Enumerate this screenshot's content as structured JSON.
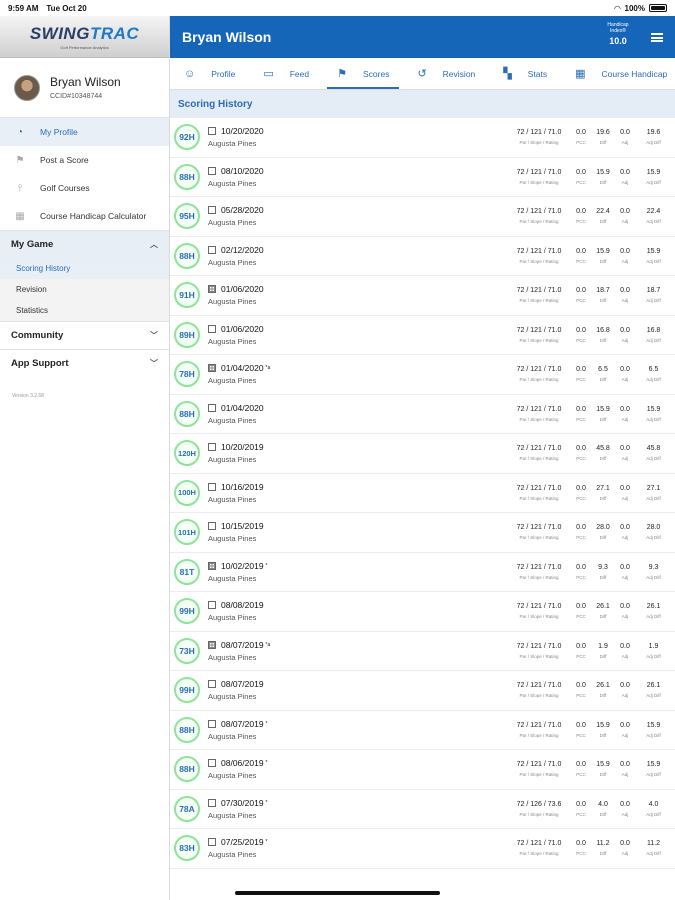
{
  "status": {
    "time": "9:59 AM",
    "date": "Tue Oct 20",
    "battery": "100%"
  },
  "brand": {
    "logo_a": "SWING",
    "logo_b": "TRAC",
    "tagline": "Golf Performance Analytics"
  },
  "user": {
    "name": "Bryan Wilson",
    "id": "CCID#10348744"
  },
  "nav": [
    {
      "label": "My Profile",
      "icon": "profile-icon",
      "glyph": "◔"
    },
    {
      "label": "Post a Score",
      "icon": "flag-icon",
      "glyph": "⚑"
    },
    {
      "label": "Golf Courses",
      "icon": "golf-tee-icon",
      "glyph": "⫯"
    },
    {
      "label": "Course Handicap Calculator",
      "icon": "calculator-icon",
      "glyph": "▦"
    }
  ],
  "sections": {
    "my_game": "My Game",
    "my_game_items": [
      "Scoring History",
      "Revision",
      "Statistics"
    ],
    "community": "Community",
    "app_support": "App Support"
  },
  "version": "Version 3.2.68",
  "header": {
    "title": "Bryan Wilson",
    "handicap_label": "Handicap Index®",
    "handicap_value": "10.0"
  },
  "tabs": [
    {
      "label": "Profile",
      "glyph": "☺"
    },
    {
      "label": "Feed",
      "glyph": "▭"
    },
    {
      "label": "Scores",
      "glyph": "⚑"
    },
    {
      "label": "Revision",
      "glyph": "↺"
    },
    {
      "label": "Stats",
      "glyph": "▚"
    },
    {
      "label": "Course Handicap",
      "glyph": "▦"
    }
  ],
  "list_title": "Scoring History",
  "stat_labels": {
    "prs": "Par / Slope / Rating",
    "pcc": "PCC",
    "diff": "Diff",
    "adj": "Adj",
    "adjdiff": "Adj Diff"
  },
  "colors": {
    "brand_blue": "#1566b8",
    "badge_border": "#8fe39a",
    "link_blue": "#2b6cb8"
  },
  "scores": [
    {
      "score": "92H",
      "date": "10/20/2020",
      "mark": "",
      "box": "plain",
      "course": "Augusta Pines",
      "prs": "72 / 121 / 71.0",
      "pcc": "0.0",
      "diff": "19.6",
      "adj": "0.0",
      "adjdiff": "19.6"
    },
    {
      "score": "88H",
      "date": "08/10/2020",
      "mark": "",
      "box": "plain",
      "course": "Augusta Pines",
      "prs": "72 / 121 / 71.0",
      "pcc": "0.0",
      "diff": "15.9",
      "adj": "0.0",
      "adjdiff": "15.9"
    },
    {
      "score": "95H",
      "date": "05/28/2020",
      "mark": "",
      "box": "plain",
      "course": "Augusta Pines",
      "prs": "72 / 121 / 71.0",
      "pcc": "0.0",
      "diff": "22.4",
      "adj": "0.0",
      "adjdiff": "22.4"
    },
    {
      "score": "88H",
      "date": "02/12/2020",
      "mark": "",
      "box": "plain",
      "course": "Augusta Pines",
      "prs": "72 / 121 / 71.0",
      "pcc": "0.0",
      "diff": "15.9",
      "adj": "0.0",
      "adjdiff": "15.9"
    },
    {
      "score": "91H",
      "date": "01/06/2020",
      "mark": "",
      "box": "grid",
      "course": "Augusta Pines",
      "prs": "72 / 121 / 71.0",
      "pcc": "0.0",
      "diff": "18.7",
      "adj": "0.0",
      "adjdiff": "18.7"
    },
    {
      "score": "89H",
      "date": "01/06/2020",
      "mark": "",
      "box": "plain",
      "course": "Augusta Pines",
      "prs": "72 / 121 / 71.0",
      "pcc": "0.0",
      "diff": "16.8",
      "adj": "0.0",
      "adjdiff": "16.8"
    },
    {
      "score": "78H",
      "date": "01/04/2020",
      "mark": "*a",
      "box": "grid",
      "course": "Augusta Pines",
      "prs": "72 / 121 / 71.0",
      "pcc": "0.0",
      "diff": "6.5",
      "adj": "0.0",
      "adjdiff": "6.5"
    },
    {
      "score": "88H",
      "date": "01/04/2020",
      "mark": "",
      "box": "plain",
      "course": "Augusta Pines",
      "prs": "72 / 121 / 71.0",
      "pcc": "0.0",
      "diff": "15.9",
      "adj": "0.0",
      "adjdiff": "15.9"
    },
    {
      "score": "120H",
      "date": "10/20/2019",
      "mark": "",
      "box": "plain",
      "course": "Augusta Pines",
      "prs": "72 / 121 / 71.0",
      "pcc": "0.0",
      "diff": "45.8",
      "adj": "0.0",
      "adjdiff": "45.8"
    },
    {
      "score": "100H",
      "date": "10/16/2019",
      "mark": "",
      "box": "plain",
      "course": "Augusta Pines",
      "prs": "72 / 121 / 71.0",
      "pcc": "0.0",
      "diff": "27.1",
      "adj": "0.0",
      "adjdiff": "27.1"
    },
    {
      "score": "101H",
      "date": "10/15/2019",
      "mark": "",
      "box": "plain",
      "course": "Augusta Pines",
      "prs": "72 / 121 / 71.0",
      "pcc": "0.0",
      "diff": "28.0",
      "adj": "0.0",
      "adjdiff": "28.0"
    },
    {
      "score": "81T",
      "date": "10/02/2019",
      "mark": "*",
      "box": "grid",
      "course": "Augusta Pines",
      "prs": "72 / 121 / 71.0",
      "pcc": "0.0",
      "diff": "9.3",
      "adj": "0.0",
      "adjdiff": "9.3"
    },
    {
      "score": "99H",
      "date": "08/08/2019",
      "mark": "",
      "box": "plain",
      "course": "Augusta Pines",
      "prs": "72 / 121 / 71.0",
      "pcc": "0.0",
      "diff": "26.1",
      "adj": "0.0",
      "adjdiff": "26.1"
    },
    {
      "score": "73H",
      "date": "08/07/2019",
      "mark": "*a",
      "box": "grid",
      "course": "Augusta Pines",
      "prs": "72 / 121 / 71.0",
      "pcc": "0.0",
      "diff": "1.9",
      "adj": "0.0",
      "adjdiff": "1.9"
    },
    {
      "score": "99H",
      "date": "08/07/2019",
      "mark": "",
      "box": "plain",
      "course": "Augusta Pines",
      "prs": "72 / 121 / 71.0",
      "pcc": "0.0",
      "diff": "26.1",
      "adj": "0.0",
      "adjdiff": "26.1"
    },
    {
      "score": "88H",
      "date": "08/07/2019",
      "mark": "*",
      "box": "plain",
      "course": "Augusta Pines",
      "prs": "72 / 121 / 71.0",
      "pcc": "0.0",
      "diff": "15.9",
      "adj": "0.0",
      "adjdiff": "15.9"
    },
    {
      "score": "88H",
      "date": "08/06/2019",
      "mark": "*",
      "box": "plain",
      "course": "Augusta Pines",
      "prs": "72 / 121 / 71.0",
      "pcc": "0.0",
      "diff": "15.9",
      "adj": "0.0",
      "adjdiff": "15.9"
    },
    {
      "score": "78A",
      "date": "07/30/2019",
      "mark": "*",
      "box": "plain",
      "course": "Augusta Pines",
      "prs": "72 / 126 / 73.6",
      "pcc": "0.0",
      "diff": "4.0",
      "adj": "0.0",
      "adjdiff": "4.0"
    },
    {
      "score": "83H",
      "date": "07/25/2019",
      "mark": "*",
      "box": "plain",
      "course": "Augusta Pines",
      "prs": "72 / 121 / 71.0",
      "pcc": "0.0",
      "diff": "11.2",
      "adj": "0.0",
      "adjdiff": "11.2"
    }
  ]
}
